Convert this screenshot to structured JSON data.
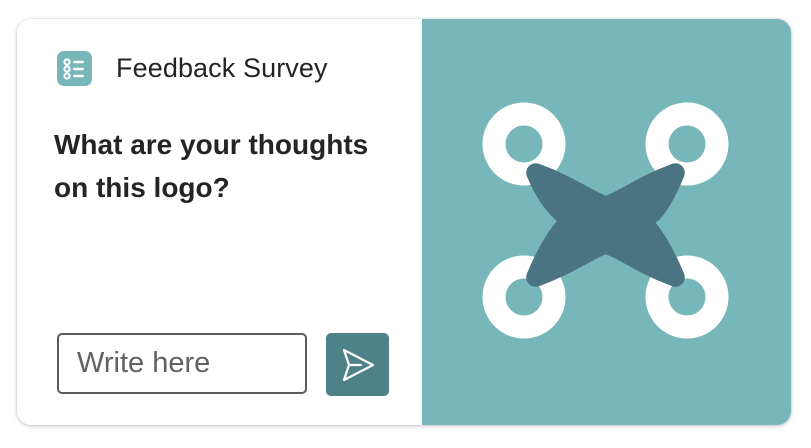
{
  "survey": {
    "title": "Feedback Survey",
    "icon": "survey-list-icon",
    "question": "What are your thoughts on this logo?",
    "answer_placeholder": "Write here",
    "answer_value": "",
    "send_icon": "send-icon"
  },
  "image": {
    "subject": "drone-logo"
  },
  "colors": {
    "accent": "#4f8188",
    "image_background": "#77b6b9",
    "logo_body": "#4b7482",
    "logo_rotors": "#ffffff",
    "text": "#242424",
    "input_border": "#5c5c5c"
  }
}
